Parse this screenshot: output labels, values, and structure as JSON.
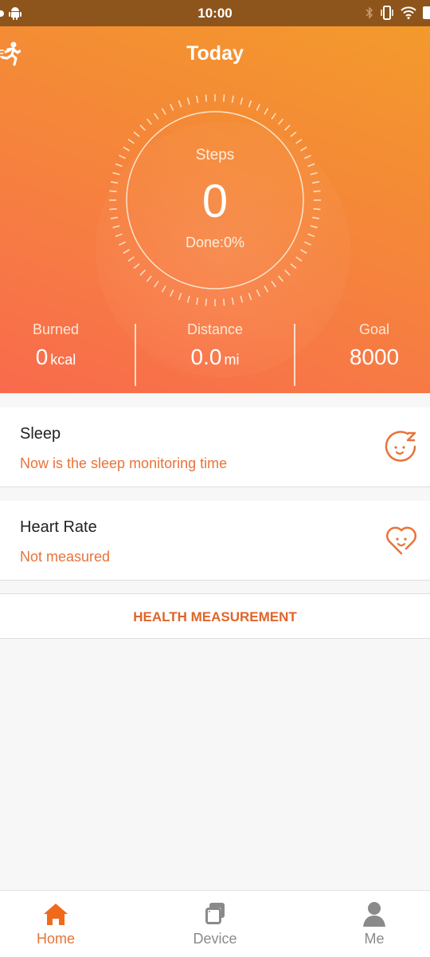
{
  "status_bar": {
    "time": "10:00",
    "left_icons": [
      "notification-dot-icon",
      "android-icon"
    ],
    "right_icons": [
      "bluetooth-icon",
      "vibrate-icon",
      "wifi-icon",
      "battery-icon"
    ]
  },
  "header": {
    "title": "Today",
    "left_icon": "running-man-icon"
  },
  "steps": {
    "label": "Steps",
    "value": "0",
    "done_text": "Done:0%",
    "progress_percent": 0
  },
  "stats": [
    {
      "label": "Burned",
      "value": "0",
      "unit": "kcal"
    },
    {
      "label": "Distance",
      "value": "0.0",
      "unit": "mi"
    },
    {
      "label": "Goal",
      "value": "8000",
      "unit": ""
    }
  ],
  "cards": {
    "sleep": {
      "title": "Sleep",
      "subtitle": "Now is the sleep monitoring time",
      "icon": "sleep-face-icon"
    },
    "heart_rate": {
      "title": "Heart Rate",
      "subtitle": "Not measured",
      "icon": "heart-face-icon"
    }
  },
  "health_button": {
    "label": "HEALTH MEASUREMENT"
  },
  "tabs": [
    {
      "label": "Home",
      "icon": "home-icon",
      "active": true
    },
    {
      "label": "Device",
      "icon": "device-icon",
      "active": false
    },
    {
      "label": "Me",
      "icon": "person-icon",
      "active": false
    }
  ],
  "colors": {
    "accent": "#e8733a",
    "status_bar": "#8d541c",
    "hero_top": "#f39a2c",
    "hero_bottom": "#f86a4c",
    "inactive": "#8a8a8a"
  }
}
